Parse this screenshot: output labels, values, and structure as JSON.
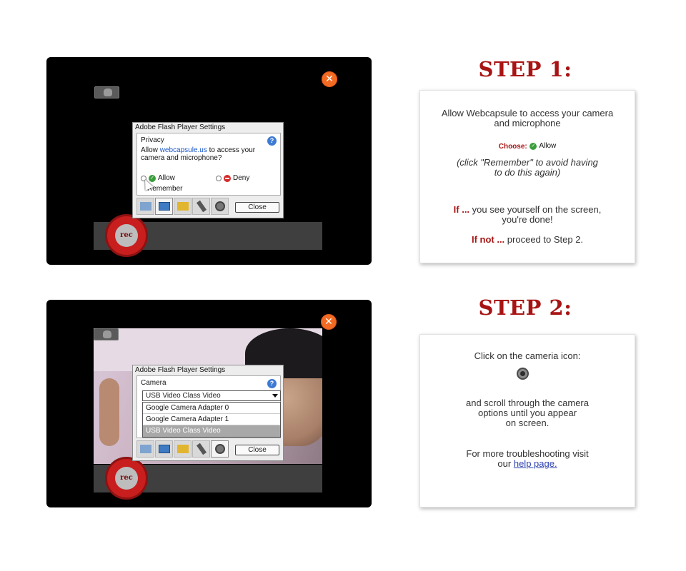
{
  "step1": {
    "title": "STEP 1:",
    "text1": "Allow Webcapsule to access your camera",
    "text2": "and microphone",
    "choose": "Choose:",
    "allow": "Allow",
    "note1": "(click \"Remember\" to avoid having",
    "note2": "to do this again)",
    "if_label": "If ...",
    "if_text1": "you see yourself on the screen,",
    "if_text2": "you're done!",
    "ifnot_label": "If not ...",
    "ifnot_text": "proceed to Step 2."
  },
  "step2": {
    "title": "STEP 2:",
    "text1": "Click on the cameria icon:",
    "text2": "and scroll through the camera",
    "text3": "options until you appear",
    "text4": "on screen.",
    "more1": "For more troubleshooting visit",
    "more2_prefix": "our",
    "link": "help page."
  },
  "flash1": {
    "title": "Adobe Flash Player Settings",
    "section": "Privacy",
    "help": "?",
    "msg_pre": "Allow",
    "msg_link": "webcapsule.us",
    "msg_post": "to access your camera and microphone?",
    "allow": "Allow",
    "deny": "Deny",
    "remember": "Remember",
    "close": "Close"
  },
  "flash2": {
    "title": "Adobe Flash Player Settings",
    "section": "Camera",
    "help": "?",
    "selected": "USB Video Class Video",
    "options": [
      "Google Camera Adapter 0",
      "Google Camera Adapter 1",
      "USB Video Class Video"
    ],
    "close": "Close"
  },
  "rec": "rec",
  "colors": {
    "accent_red": "#a81414",
    "close_orange": "#f36b23",
    "link_blue": "#2a3fae"
  },
  "icons": [
    "close-x-icon",
    "camera-toggle-icon",
    "help-icon",
    "allow-check-icon",
    "deny-icon",
    "webcam-icon",
    "cursor-icon"
  ]
}
